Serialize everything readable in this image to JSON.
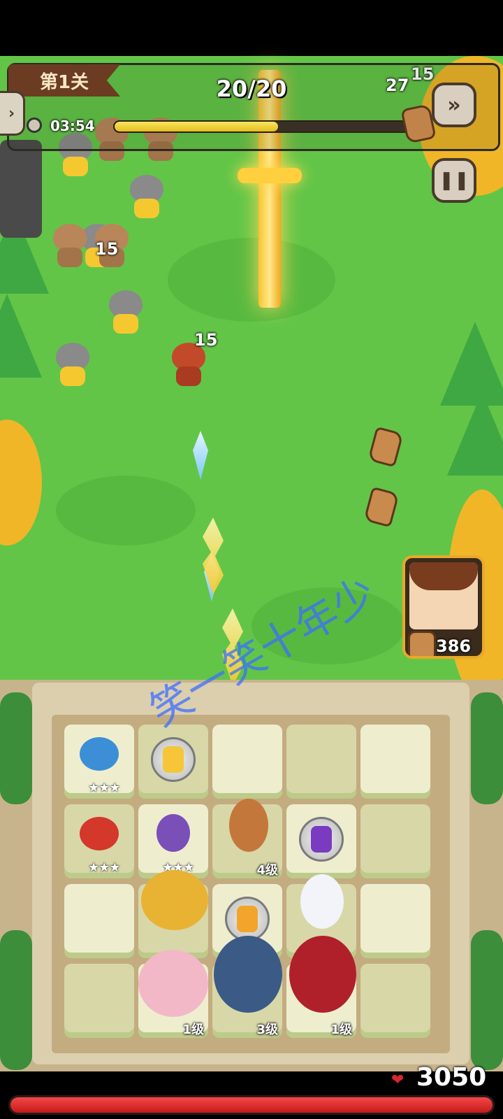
{
  "hud": {
    "stage_label": "第1关",
    "wave_count": "20/20",
    "timer": "03:54",
    "wave_progress": 0.55,
    "enemy_count": "27",
    "fast_forward_icon": "fast-forward-icon",
    "pause_icon": "pause-icon",
    "side_tab_icon": "chevron-right-icon"
  },
  "field": {
    "damage_numbers": [
      "15",
      "15",
      "15"
    ],
    "hero_card_value": "386"
  },
  "watermark": "笑一笑十年少",
  "board": {
    "cells": [
      {
        "unit": "blue-pokemon",
        "stars": "★★★"
      },
      {
        "unit": "sword-tool"
      },
      {
        "unit": ""
      },
      {
        "unit": ""
      },
      {
        "unit": ""
      },
      {
        "unit": "fire-bird",
        "stars": "★★★"
      },
      {
        "unit": "purple-monkey",
        "stars": "★★★"
      },
      {
        "unit": "hero-boy",
        "level": "4级"
      },
      {
        "unit": "purple-dice-tool"
      },
      {
        "unit": ""
      },
      {
        "unit": ""
      },
      {
        "unit": "gold-dragon"
      },
      {
        "unit": "sword-dice-tool"
      },
      {
        "unit": "white-rabbit"
      },
      {
        "unit": ""
      },
      {
        "unit": ""
      },
      {
        "unit": "fox-girl",
        "level": "1级"
      },
      {
        "unit": "dark-knight",
        "level": "3级"
      },
      {
        "unit": "red-witch",
        "level": "1级"
      },
      {
        "unit": ""
      }
    ]
  },
  "player": {
    "hp": "3050",
    "hp_fraction": 1.0,
    "heart_icon": "heart-icon"
  },
  "colors": {
    "grass": "#62c548",
    "hp_bar": "#e12b2b",
    "progress_fill": "#f2d33a",
    "watermark": "#3c6eff"
  }
}
